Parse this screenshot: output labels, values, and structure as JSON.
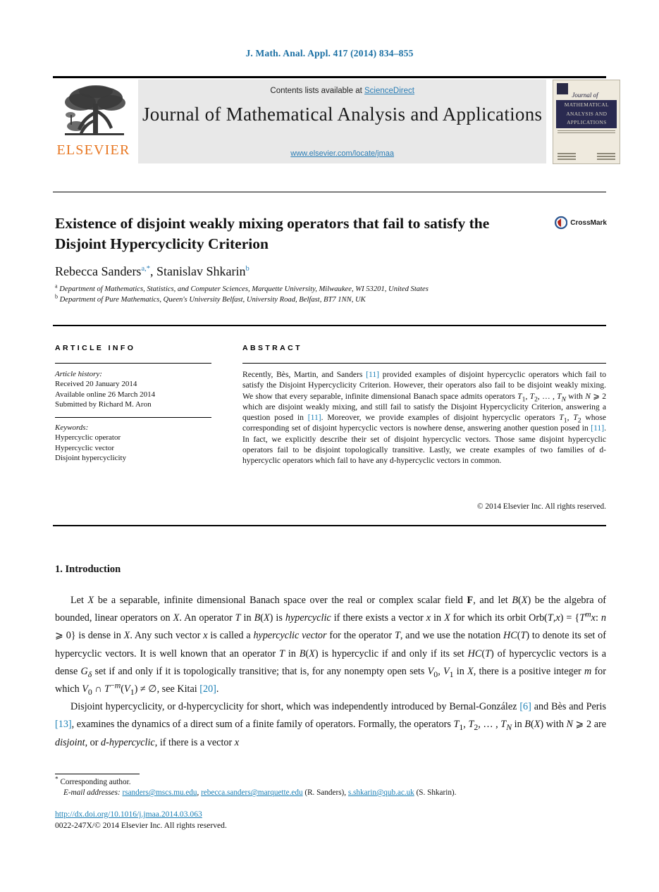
{
  "running_head": "J. Math. Anal. Appl. 417 (2014) 834–855",
  "masthead": {
    "contents_prefix": "Contents lists available at ",
    "sciencedirect": "ScienceDirect",
    "journal_title": "Journal of Mathematical Analysis and Applications",
    "journal_url": "www.elsevier.com/locate/jmaa",
    "publisher_wordmark": "ELSEVIER",
    "publisher_logo_icon": "elsevier-tree-icon",
    "cover": {
      "journal_of": "Journal of",
      "band_title": "MATHEMATICAL ANALYSIS AND APPLICATIONS"
    }
  },
  "article": {
    "title": "Existence of disjoint weakly mixing operators that fail to satisfy the Disjoint Hypercyclicity Criterion",
    "crossmark_label": "CrossMark",
    "authors_html": "Rebecca Sanders<sup>a,*</sup>, Stanislav Shkarin<sup>b</sup>",
    "affiliation_a": "Department of Mathematics, Statistics, and Computer Sciences, Marquette University, Milwaukee, WI 53201, United States",
    "affiliation_b": "Department of Pure Mathematics, Queen's University Belfast, University Road, Belfast, BT7 1NN, UK"
  },
  "columns": {
    "info_heading": "ARTICLE INFO",
    "abstract_heading": "ABSTRACT"
  },
  "info": {
    "history_label": "Article history:",
    "received": "Received 20 January 2014",
    "available_online": "Available online 26 March 2014",
    "submitted_by": "Submitted by Richard M. Aron",
    "keywords_label": "Keywords:",
    "keywords": [
      "Hypercyclic operator",
      "Hypercyclic vector",
      "Disjoint hypercyclicity"
    ]
  },
  "abstract": {
    "text": "Recently, Bès, Martin, and Sanders [11] provided examples of disjoint hypercyclic operators which fail to satisfy the Disjoint Hypercyclicity Criterion. However, their operators also fail to be disjoint weakly mixing. We show that every separable, infinite dimensional Banach space admits operators T1, T2, … , TN with N ⩾ 2 which are disjoint weakly mixing, and still fail to satisfy the Disjoint Hypercyclicity Criterion, answering a question posed in [11]. Moreover, we provide examples of disjoint hypercyclic operators T1, T2 whose corresponding set of disjoint hypercyclic vectors is nowhere dense, answering another question posed in [11]. In fact, we explicitly describe their set of disjoint hypercyclic vectors. Those same disjoint hypercyclic operators fail to be disjoint topologically transitive. Lastly, we create examples of two families of d-hypercyclic operators which fail to have any d-hypercyclic vectors in common.",
    "copyright": "© 2014 Elsevier Inc. All rights reserved.",
    "refs": [
      "[11]"
    ]
  },
  "section": {
    "number_title": "1. Introduction",
    "paragraph_1": "Let X be a separable, infinite dimensional Banach space over the real or complex scalar field F, and let B(X) be the algebra of bounded, linear operators on X. An operator T in B(X) is hypercyclic if there exists a vector x in X for which its orbit Orb(T,x) = {Tmx: n ⩾ 0} is dense in X. Any such vector x is called a hypercyclic vector for the operator T, and we use the notation HC(T) to denote its set of hypercyclic vectors. It is well known that an operator T in B(X) is hypercyclic if and only if its set HC(T) of hypercyclic vectors is a dense Gδ set if and only if it is topologically transitive; that is, for any nonempty open sets V0, V1 in X, there is a positive integer m for which V0 ∩ T−m(V1) ≠ ∅, see Kitai [20].",
    "paragraph_2": "Disjoint hypercyclicity, or d-hypercyclicity for short, which was independently introduced by Bernal-González [6] and Bès and Peris [13], examines the dynamics of a direct sum of a finite family of operators. Formally, the operators T1, T2, … , TN in B(X) with N ⩾ 2 are disjoint, or d-hypercyclic, if there is a vector x"
  },
  "footnotes": {
    "corresponding_marker": "*",
    "corresponding_text": "Corresponding author.",
    "email_label": "E-mail addresses:",
    "email_1": "rsanders@mscs.mu.edu",
    "email_2": "rebecca.sanders@marquette.edu",
    "email_1_owner": "(R. Sanders)",
    "email_3": "s.shkarin@qub.ac.uk",
    "email_3_owner": "(S. Shkarin)."
  },
  "footer": {
    "doi": "http://dx.doi.org/10.1016/j.jmaa.2014.03.063",
    "issn_line": "0022-247X/© 2014 Elsevier Inc. All rights reserved."
  },
  "colors": {
    "link": "#1a7fb5",
    "elsevier_orange": "#E87722",
    "cover_navy": "#2a2a50"
  }
}
